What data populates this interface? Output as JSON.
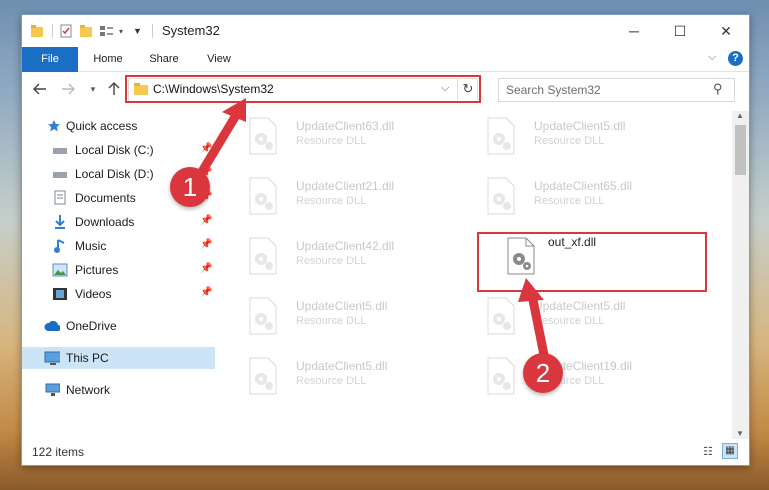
{
  "window": {
    "title": "System32",
    "controls": {
      "minimize": "─",
      "maximize": "☐",
      "close": "✕"
    }
  },
  "ribbon": {
    "tabs": [
      "File",
      "Home",
      "Share",
      "View"
    ]
  },
  "address": {
    "path": "C:\\Windows\\System32",
    "search_placeholder": "Search System32"
  },
  "nav": {
    "quick_access": "Quick access",
    "items": [
      {
        "label": "Local Disk (C:)",
        "icon": "drive-icon",
        "pinned": true
      },
      {
        "label": "Local Disk (D:)",
        "icon": "drive-icon",
        "pinned": true
      },
      {
        "label": "Documents",
        "icon": "documents-icon",
        "pinned": true
      },
      {
        "label": "Downloads",
        "icon": "downloads-icon",
        "pinned": true
      },
      {
        "label": "Music",
        "icon": "music-icon",
        "pinned": true
      },
      {
        "label": "Pictures",
        "icon": "pictures-icon",
        "pinned": true
      },
      {
        "label": "Videos",
        "icon": "videos-icon",
        "pinned": true
      }
    ],
    "onedrive": "OneDrive",
    "thispc": "This PC",
    "network": "Network"
  },
  "files": [
    {
      "name": "UpdateClient63.dll",
      "type": "Resource DLL"
    },
    {
      "name": "UpdateClient5.dll",
      "type": "Resource DLL"
    },
    {
      "name": "UpdateClient21.dll",
      "type": "Resource DLL"
    },
    {
      "name": "UpdateClient65.dll",
      "type": "Resource DLL"
    },
    {
      "name": "UpdateClient42.dll",
      "type": "Resource DLL"
    },
    {
      "name": "out_xf.dll",
      "type": ""
    },
    {
      "name": "UpdateClient5.dll",
      "type": "Resource DLL"
    },
    {
      "name": "UpdateClient5.dll",
      "type": "Resource DLL"
    },
    {
      "name": "UpdateClient5.dll",
      "type": "Resource DLL"
    },
    {
      "name": "UpdateClient19.dll",
      "type": "Resource DLL"
    }
  ],
  "status": {
    "items": "122 items"
  },
  "annotations": {
    "step1": "1",
    "step2": "2"
  },
  "colors": {
    "accent": "#1a6fc4",
    "highlight": "#d9363e",
    "selection": "#cce4f7"
  }
}
